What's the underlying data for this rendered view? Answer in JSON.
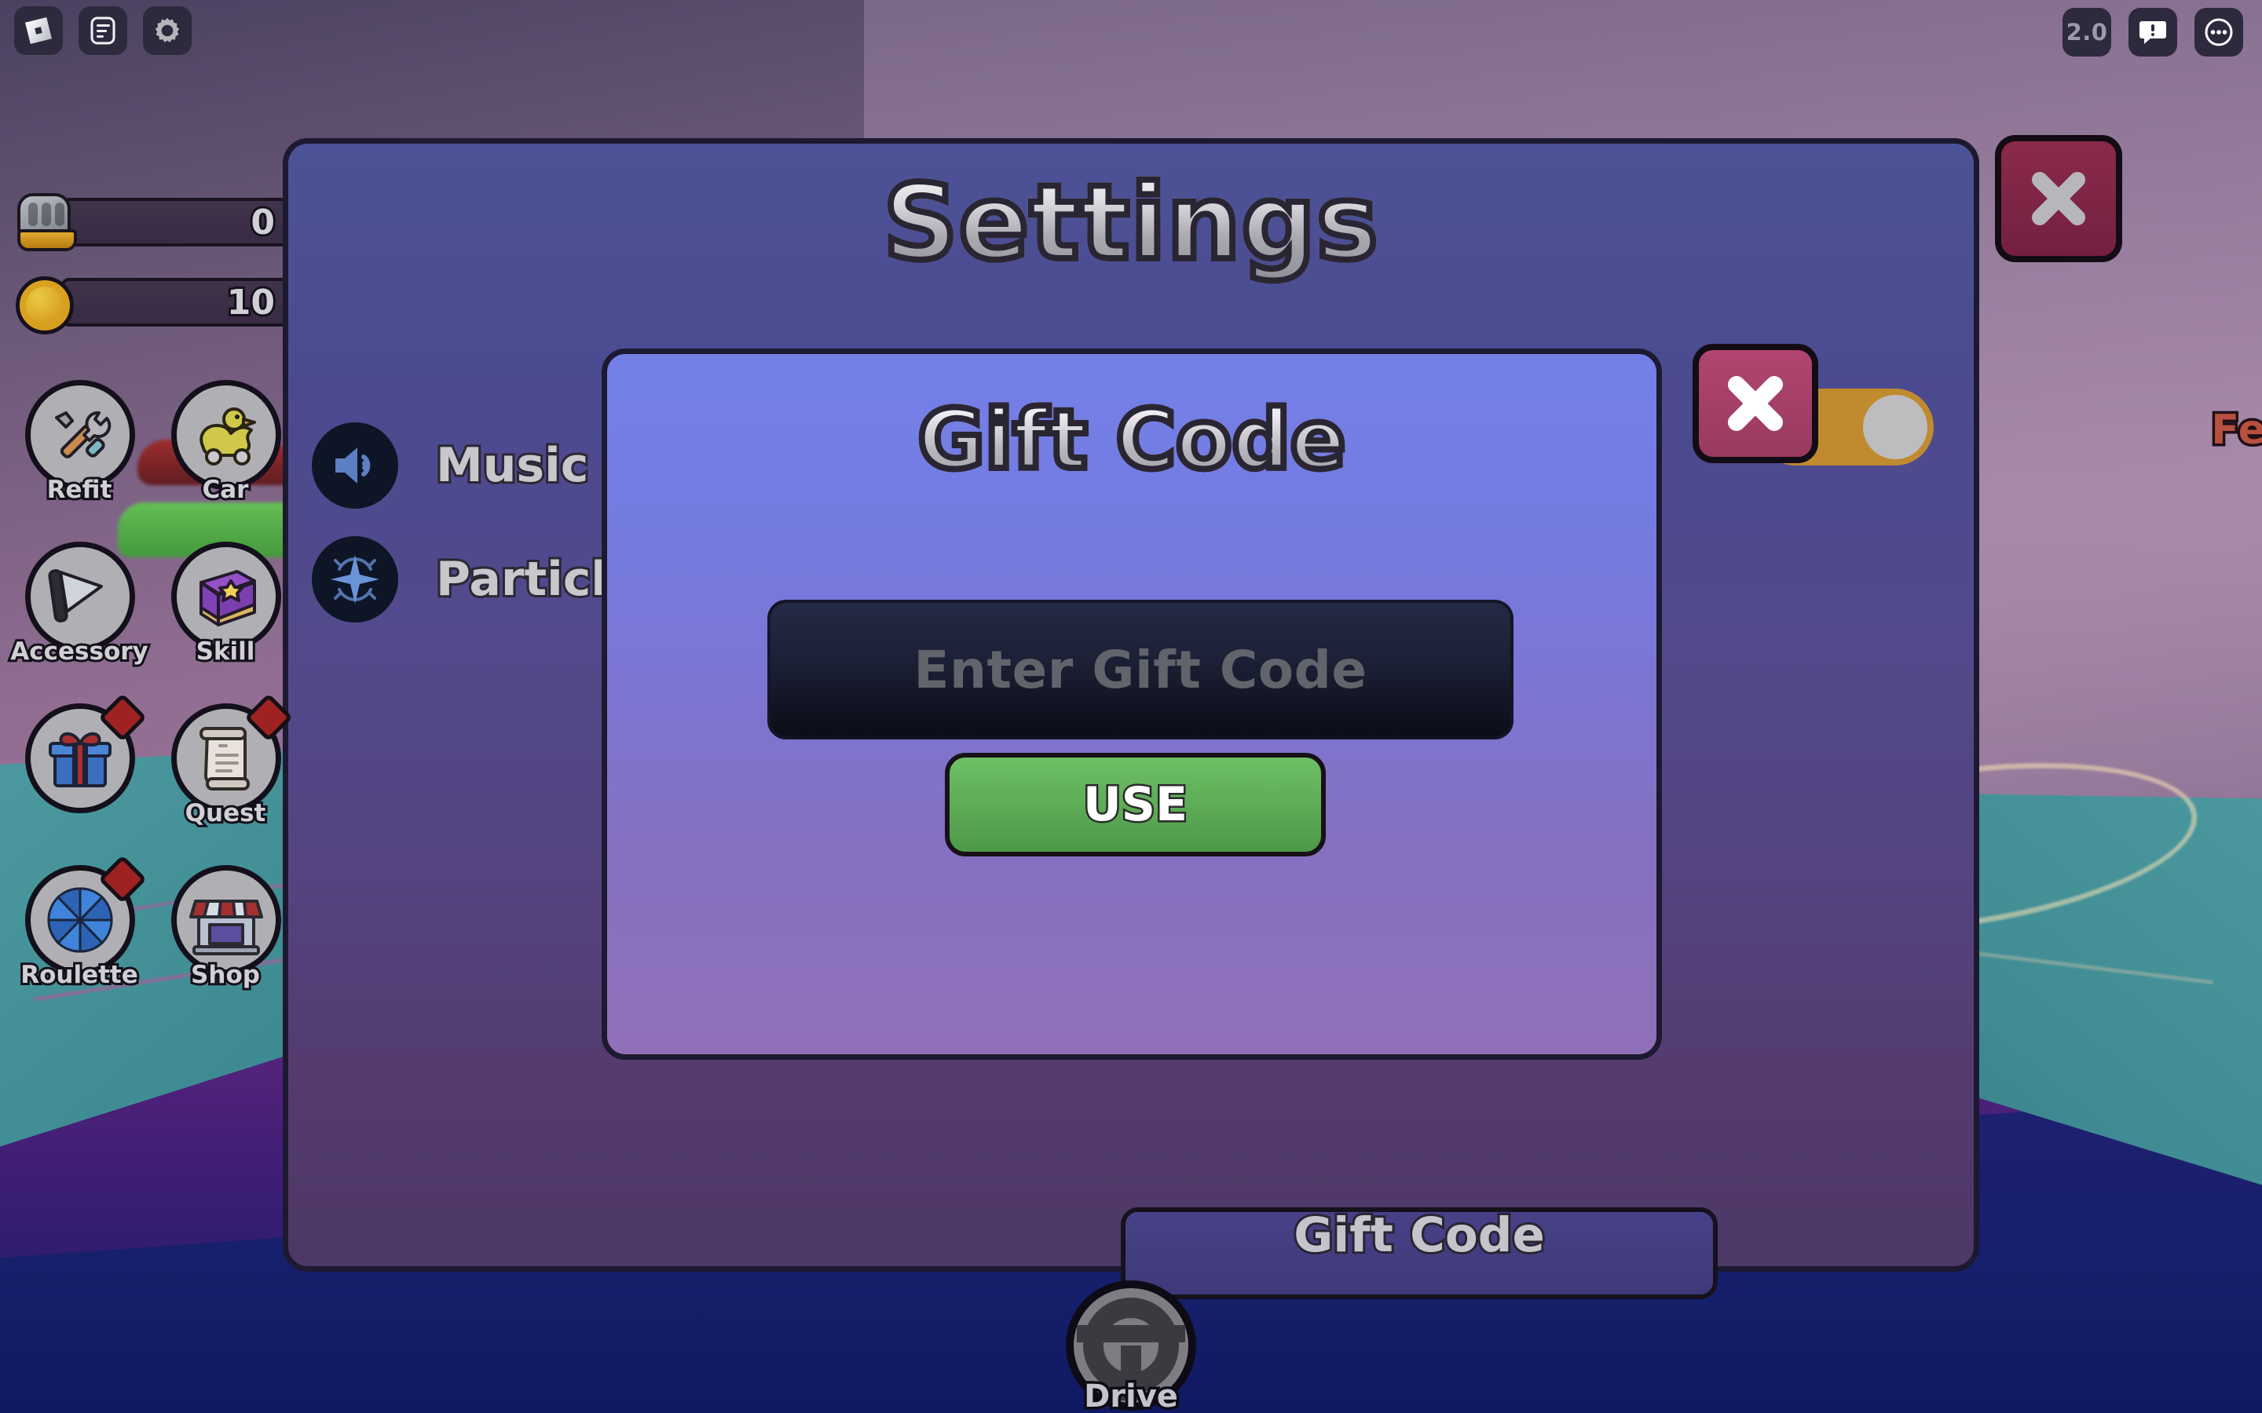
{
  "topbar": {
    "left_buttons": [
      {
        "name": "roblox-logo-icon",
        "label": "Roblox"
      },
      {
        "name": "chat-icon",
        "label": "Chat"
      },
      {
        "name": "gear-icon",
        "label": "Settings"
      }
    ],
    "right_buttons": [
      {
        "name": "version-badge",
        "label": "2.0"
      },
      {
        "name": "chat-alert-icon",
        "label": "Notifications"
      },
      {
        "name": "more-menu-icon",
        "label": "More"
      }
    ]
  },
  "hud": {
    "stats": [
      {
        "icon": "fist-icon",
        "value": "0"
      },
      {
        "icon": "coin-icon",
        "value": "10"
      }
    ],
    "buttons": [
      {
        "label": "Refit",
        "icon": "tools-icon",
        "badge": false
      },
      {
        "label": "Car",
        "icon": "duck-car-icon",
        "badge": false
      },
      {
        "label": "Accessory",
        "icon": "cone-icon",
        "badge": false
      },
      {
        "label": "Skill",
        "icon": "book-icon",
        "badge": false
      },
      {
        "label": "",
        "icon": "gift-icon",
        "badge": true
      },
      {
        "label": "Quest",
        "icon": "scroll-icon",
        "badge": true
      },
      {
        "label": "Roulette",
        "icon": "wheel-icon",
        "badge": true
      },
      {
        "label": "Shop",
        "icon": "shop-icon",
        "badge": false
      }
    ]
  },
  "settings": {
    "title": "Settings",
    "rows": [
      {
        "label": "Music",
        "icon": "speaker-icon",
        "toggle": "on"
      },
      {
        "label": "Particle",
        "icon": "sparkle-icon",
        "toggle": "on"
      }
    ],
    "gift_code_button": "Gift Code",
    "close_button": "close-icon"
  },
  "gift_modal": {
    "title": "Gift Code",
    "input_placeholder": "Enter Gift Code",
    "input_value": "",
    "use_button": "USE",
    "close_button": "close-icon"
  },
  "drive": {
    "label": "Drive",
    "icon": "steering-wheel-icon"
  },
  "background": {
    "right_label": "Fe"
  },
  "colors": {
    "panel_blue": "#4c5296",
    "modal_blue": "#7480e8",
    "accent_green": "#5fae58",
    "close_red": "#8a2a4b",
    "toggle_on": "#c08a2f",
    "badge_red": "#9e2222"
  }
}
